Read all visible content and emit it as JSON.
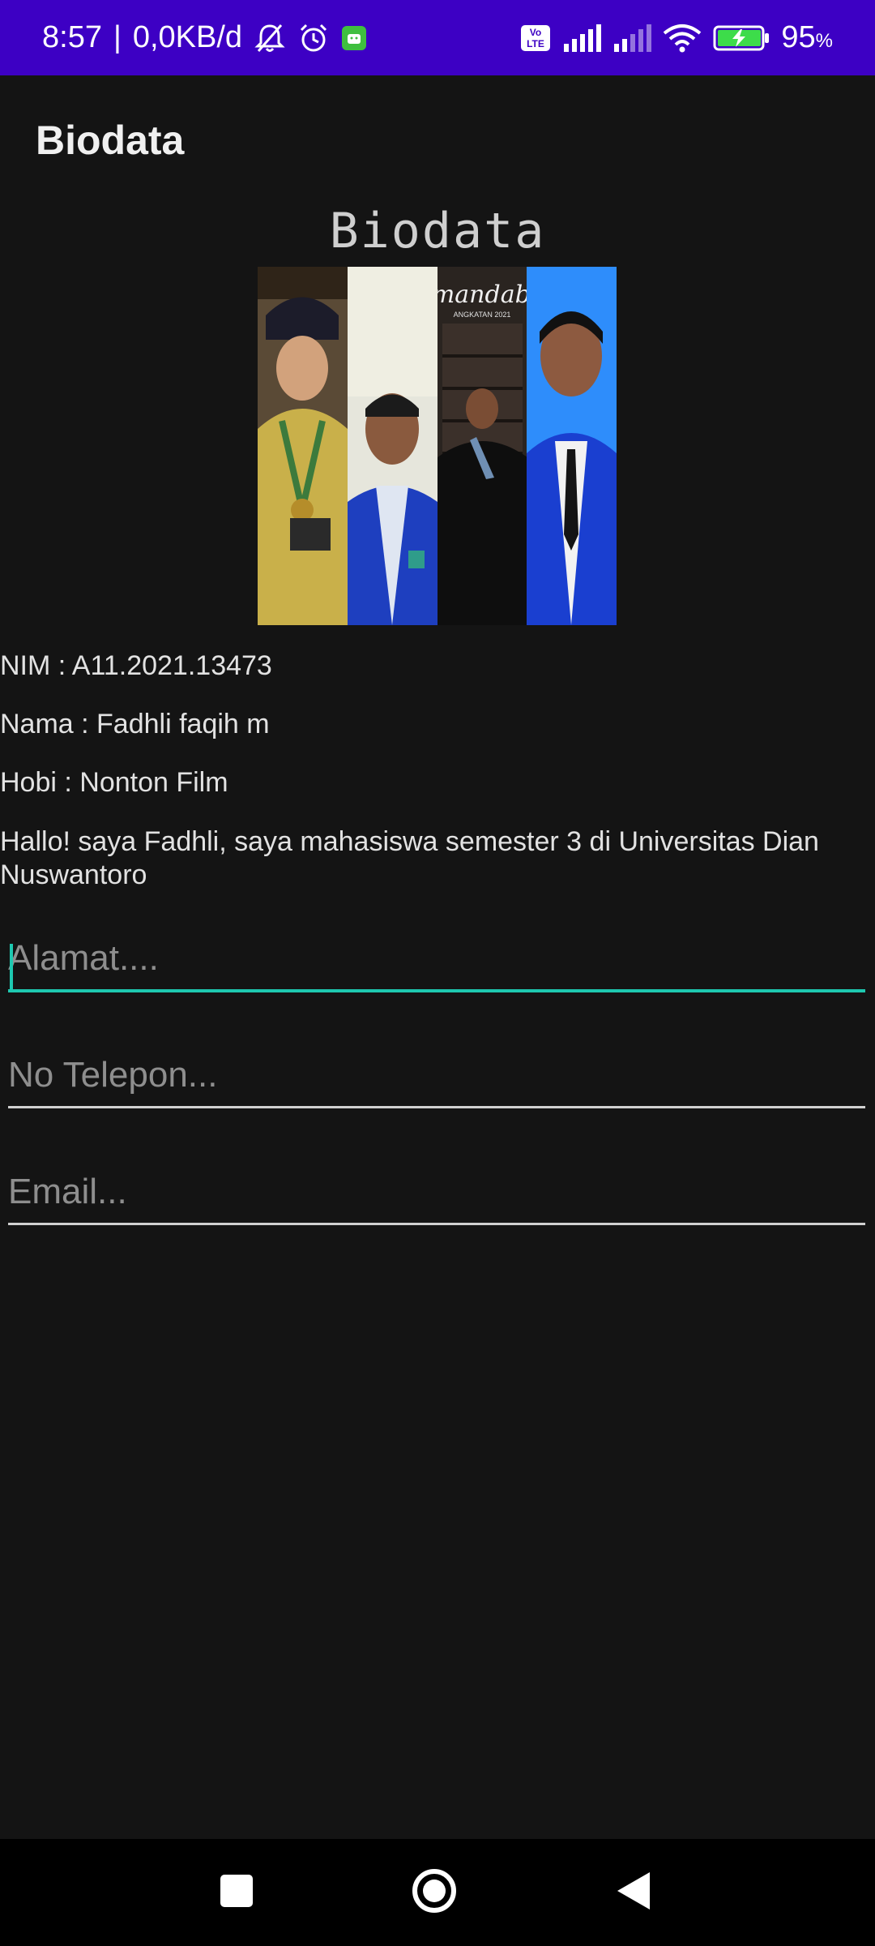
{
  "status_bar": {
    "time": "8:57",
    "separator": "|",
    "data_rate": "0,0KB/d",
    "battery": "95",
    "battery_unit": "%",
    "volte": "Vo LTE",
    "icons": [
      "bell-off-icon",
      "alarm-icon",
      "android-app-icon",
      "volte-icon",
      "signal-icon",
      "signal-weak-icon",
      "wifi-icon",
      "battery-charging-icon"
    ]
  },
  "app_bar": {
    "title": "Biodata"
  },
  "main": {
    "heading": "Biodata",
    "nim": "NIM : A11.2021.13473",
    "nama": "Nama : Fadhli faqih m",
    "hobi": "Hobi : Nonton Film",
    "bio": "Hallo! saya Fadhli, saya mahasiswa semester 3 di Universitas Dian Nuswantoro",
    "photo_caption": "smandabe",
    "photo_subcaption": "ANGKATAN 2021"
  },
  "form": {
    "alamat_placeholder": "Alamat....",
    "telepon_placeholder": "No Telepon...",
    "email_placeholder": "Email..."
  },
  "nav_bar": {
    "icons": [
      "recents-square-icon",
      "home-circle-icon",
      "back-triangle-icon"
    ]
  },
  "colors": {
    "status_bar": "#3d00c4",
    "background": "#141414",
    "accent": "#1ec8b0"
  }
}
